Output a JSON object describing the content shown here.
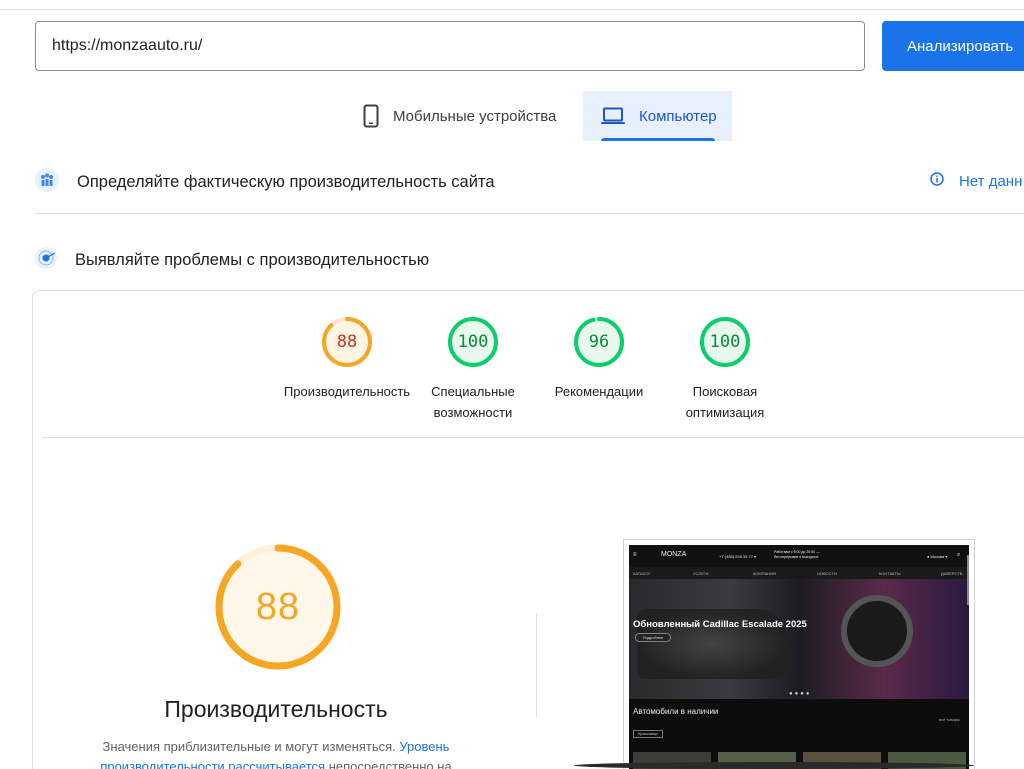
{
  "search": {
    "value": "https://monzaauto.ru/",
    "button_label": "Анализировать"
  },
  "tabs": [
    {
      "label": "Мобильные устройства",
      "icon": "smartphone-icon",
      "selected": false
    },
    {
      "label": "Компьютер",
      "icon": "laptop-icon",
      "selected": true
    }
  ],
  "field_data": {
    "title": "Определяйте фактическую производительность сайта",
    "status": "Нет данн"
  },
  "lab_data": {
    "title": "Выявляйте проблемы с производительностью"
  },
  "scores": [
    {
      "value": "88",
      "score": 88,
      "label": "Производительность",
      "color": "#f5a623",
      "text_color": "#c8321e"
    },
    {
      "value": "100",
      "score": 100,
      "label": "Специальные возможности",
      "color": "#0cce6b",
      "text_color": "#0a8a3a"
    },
    {
      "value": "96",
      "score": 96,
      "label": "Рекомендации",
      "color": "#0cce6b",
      "text_color": "#0a8a3a"
    },
    {
      "value": "100",
      "score": 100,
      "label": "Поисковая оптимизация",
      "color": "#0cce6b",
      "text_color": "#0a8a3a"
    }
  ],
  "performance": {
    "score": "88",
    "score_value": 88,
    "title": "Производительность",
    "desc_prefix": "Значения приблизительные и могут изменяться. ",
    "desc_link": "Уровень производительности рассчитывается",
    "desc_suffix": " непосредственно на"
  },
  "thumbnail": {
    "brand": "MONZA",
    "phone": "+7 (495) 226 33 77 ▾",
    "hours": "Работаем с 9:00 до 20:00 —",
    "hours2": "без перерывов и выходных",
    "city": "● Москва ▾",
    "nav": [
      "КАТАЛОГ",
      "УСЛУГИ",
      "КОМПАНИЯ",
      "НОВОСТИ",
      "КОНТАКТЫ",
      "ДИЛЕРСТВ"
    ],
    "hero_title": "Обновленный Cadillac Escalade 2025",
    "hero_button": "Подробнее",
    "section": "Автомобили в наличии",
    "all_link": "все товары",
    "chip": "Кроссовер"
  },
  "colors": {
    "accent": "#1a73e8",
    "average": "#f5a623",
    "good": "#0cce6b"
  }
}
